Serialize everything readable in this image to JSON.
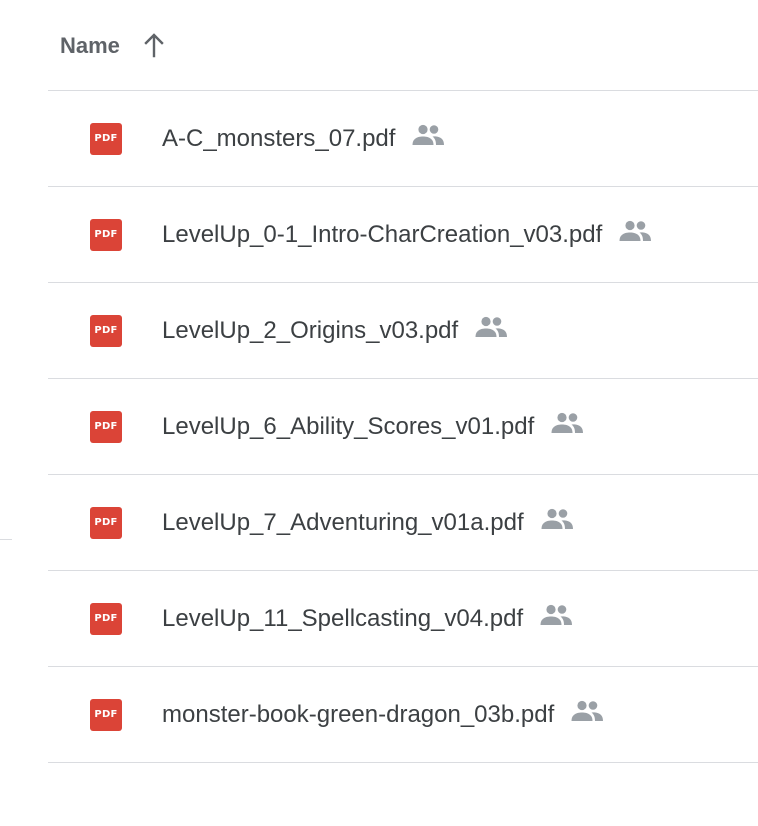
{
  "header": {
    "name_label": "Name",
    "sort_icon": "arrow-up-icon"
  },
  "files": [
    {
      "name": "A-C_monsters_07.pdf",
      "type_badge": "PDF",
      "icon": "pdf-icon",
      "shared_icon": "people-icon"
    },
    {
      "name": "LevelUp_0-1_Intro-CharCreation_v03.pdf",
      "type_badge": "PDF",
      "icon": "pdf-icon",
      "shared_icon": "people-icon"
    },
    {
      "name": "LevelUp_2_Origins_v03.pdf",
      "type_badge": "PDF",
      "icon": "pdf-icon",
      "shared_icon": "people-icon"
    },
    {
      "name": "LevelUp_6_Ability_Scores_v01.pdf",
      "type_badge": "PDF",
      "icon": "pdf-icon",
      "shared_icon": "people-icon"
    },
    {
      "name": "LevelUp_7_Adventuring_v01a.pdf",
      "type_badge": "PDF",
      "icon": "pdf-icon",
      "shared_icon": "people-icon"
    },
    {
      "name": "LevelUp_11_Spellcasting_v04.pdf",
      "type_badge": "PDF",
      "icon": "pdf-icon",
      "shared_icon": "people-icon"
    },
    {
      "name": "monster-book-green-dragon_03b.pdf",
      "type_badge": "PDF",
      "icon": "pdf-icon",
      "shared_icon": "people-icon"
    }
  ],
  "colors": {
    "pdf_red": "#db4437",
    "text": "#3c4043",
    "header_text": "#5f6368",
    "icon_gray": "#9aa0a6",
    "divider": "#dadce0"
  }
}
